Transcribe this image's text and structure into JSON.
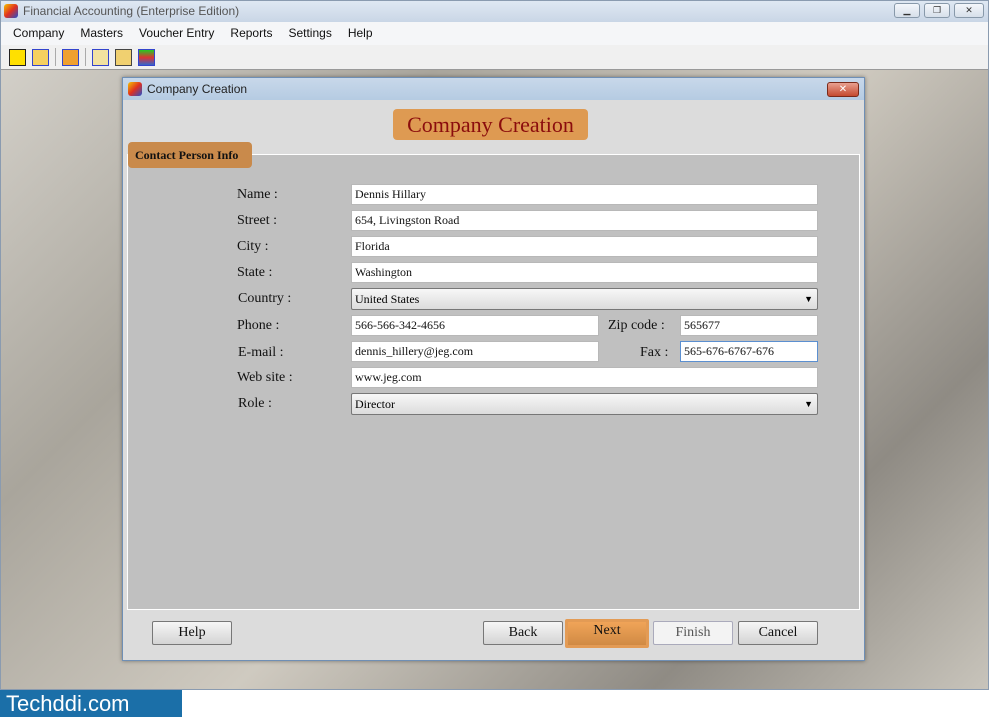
{
  "app": {
    "title": "Financial Accounting (Enterprise Edition)",
    "window_buttons": [
      "minimize",
      "restore",
      "close"
    ]
  },
  "menu": [
    "Company",
    "Masters",
    "Voucher Entry",
    "Reports",
    "Settings",
    "Help"
  ],
  "toolbar": [
    "new-icon",
    "open-folder-icon",
    "calculator-icon",
    "balance-scale-icon",
    "note-icon",
    "plus-minus-icon"
  ],
  "dialog": {
    "title": "Company Creation",
    "heading": "Company Creation",
    "tab": "Contact Person Info",
    "fields": {
      "name": {
        "label": "Name :",
        "value": "Dennis Hillary"
      },
      "street": {
        "label": "Street :",
        "value": "654, Livingston Road"
      },
      "city": {
        "label": "City :",
        "value": "Florida"
      },
      "state": {
        "label": "State :",
        "value": "Washington"
      },
      "country": {
        "label": "Country :",
        "value": "United States"
      },
      "phone": {
        "label": "Phone :",
        "value": "566-566-342-4656"
      },
      "zip": {
        "label": "Zip code :",
        "value": "565677"
      },
      "email": {
        "label": "E-mail :",
        "value": "dennis_hillery@jeg.com"
      },
      "fax": {
        "label": "Fax :",
        "value": "565-676-6767-676"
      },
      "website": {
        "label": "Web site :",
        "value": "www.jeg.com"
      },
      "role": {
        "label": "Role :",
        "value": "Director"
      }
    },
    "buttons": {
      "help": "Help",
      "back": "Back",
      "next": "Next",
      "finish": "Finish",
      "cancel": "Cancel"
    }
  },
  "watermark": "Techddi.com",
  "colors": {
    "accent": "#de9a52",
    "heading_text": "#8b0d0d"
  }
}
